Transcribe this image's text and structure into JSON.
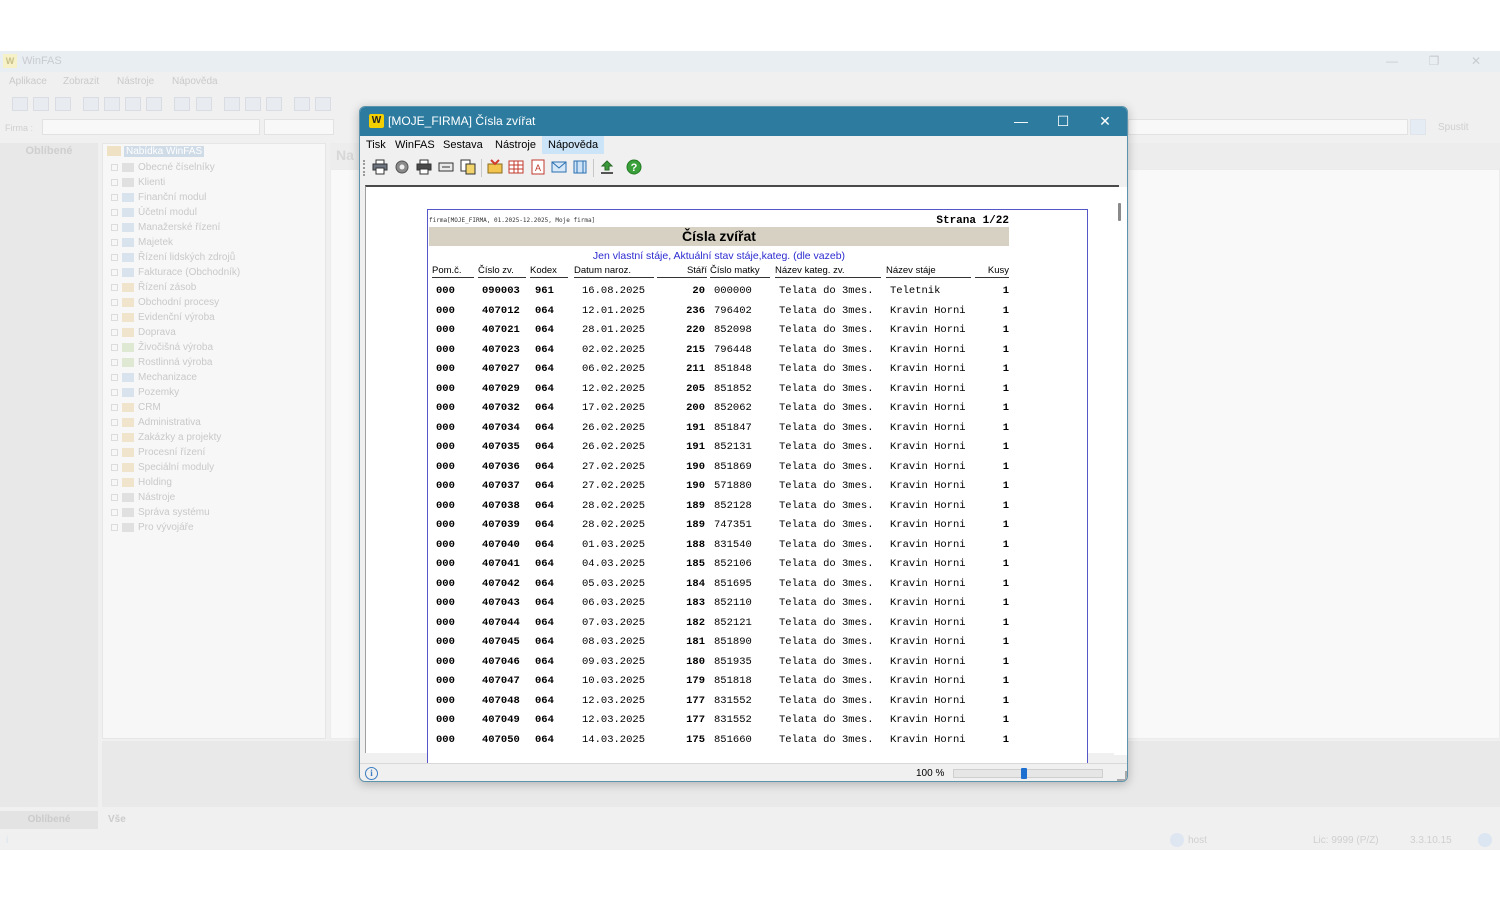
{
  "main_window": {
    "title": "WinFAS",
    "app_icon_text": "W",
    "menu": [
      "Aplikace",
      "Zobrazit",
      "Nástroje",
      "Nápověda"
    ],
    "firma_label": "Firma :",
    "spust_label": "Spustit",
    "favorites_header": "Oblíbené",
    "tree_root": "Nabídka WinFAS",
    "right_header": "Na",
    "tree_items": [
      {
        "label": "Obecné číselníky",
        "color": "gray"
      },
      {
        "label": "Klienti",
        "color": "gray"
      },
      {
        "label": "Finanční modul",
        "color": "blue"
      },
      {
        "label": "Účetní modul",
        "color": "blue"
      },
      {
        "label": "Manažerské řízení",
        "color": "blue"
      },
      {
        "label": "Majetek",
        "color": "blue"
      },
      {
        "label": "Řízení lidských zdrojů",
        "color": "blue"
      },
      {
        "label": "Fakturace (Obchodník)",
        "color": "blue"
      },
      {
        "label": "Řízení zásob",
        "color": "orange"
      },
      {
        "label": "Obchodní procesy",
        "color": "orange"
      },
      {
        "label": "Evidenční výroba",
        "color": "orange"
      },
      {
        "label": "Doprava",
        "color": "orange"
      },
      {
        "label": "Živočišná výroba",
        "color": "green"
      },
      {
        "label": "Rostlinná výroba",
        "color": "green"
      },
      {
        "label": "Mechanizace",
        "color": "blue"
      },
      {
        "label": "Pozemky",
        "color": "blue"
      },
      {
        "label": "CRM",
        "color": "orange"
      },
      {
        "label": "Administrativa",
        "color": "orange"
      },
      {
        "label": "Zakázky a projekty",
        "color": "orange"
      },
      {
        "label": "Procesní řízení",
        "color": "orange"
      },
      {
        "label": "Speciální moduly",
        "color": "orange"
      },
      {
        "label": "Holding",
        "color": "orange"
      },
      {
        "label": "Nástroje",
        "color": "gray"
      },
      {
        "label": "Správa systému",
        "color": "gray"
      },
      {
        "label": "Pro vývojáře",
        "color": "gray"
      }
    ],
    "bottom_tabs": {
      "favorites": "Oblíbené",
      "all": "Vše"
    },
    "status": {
      "user": "host",
      "license": "Lic: 9999 (P/Z)",
      "version": "3.3.10.15",
      "info": "i"
    }
  },
  "report_window": {
    "title": "[MOJE_FIRMA] Čísla zvířat",
    "app_icon_text": "W",
    "controls": {
      "minimize": "—",
      "maximize": "☐",
      "close": "✕"
    },
    "menu": [
      {
        "label": "Tisk",
        "active": false
      },
      {
        "label": "WinFAS",
        "active": false
      },
      {
        "label": "Sestava",
        "active": false
      },
      {
        "label": "Nástroje",
        "active": false
      },
      {
        "label": "Nápověda",
        "active": true
      }
    ],
    "status": {
      "info": "i",
      "zoom_label": "100 %",
      "zoom_value": 0.47
    }
  },
  "report": {
    "meta": "firma[MOJE_FIRMA, 01.2025-12.2025, Moje firma]",
    "page": "Strana 1/22",
    "title": "Čísla zvířat",
    "filter": "Jen vlastní stáje, Aktuální stav stáje,kateg. (dle vazeb)",
    "columns": {
      "pom": "Pom.č.",
      "cislo": "Číslo zv.",
      "kodex": "Kodex",
      "datum": "Datum naroz.",
      "stari": "Stáří",
      "matka": "Číslo matky",
      "kateg": "Název kateg. zv.",
      "staj": "Název stáje",
      "kusy": "Kusy"
    },
    "rows": [
      [
        "000",
        "090003",
        "961",
        "16.08.2025",
        "20",
        "000000",
        "Telata do 3mes.",
        "Teletnik",
        "1"
      ],
      [
        "000",
        "407012",
        "064",
        "12.01.2025",
        "236",
        "796402",
        "Telata do 3mes.",
        "Kravin Horni",
        "1"
      ],
      [
        "000",
        "407021",
        "064",
        "28.01.2025",
        "220",
        "852098",
        "Telata do 3mes.",
        "Kravin Horni",
        "1"
      ],
      [
        "000",
        "407023",
        "064",
        "02.02.2025",
        "215",
        "796448",
        "Telata do 3mes.",
        "Kravin Horni",
        "1"
      ],
      [
        "000",
        "407027",
        "064",
        "06.02.2025",
        "211",
        "851848",
        "Telata do 3mes.",
        "Kravin Horni",
        "1"
      ],
      [
        "000",
        "407029",
        "064",
        "12.02.2025",
        "205",
        "851852",
        "Telata do 3mes.",
        "Kravin Horni",
        "1"
      ],
      [
        "000",
        "407032",
        "064",
        "17.02.2025",
        "200",
        "852062",
        "Telata do 3mes.",
        "Kravin Horni",
        "1"
      ],
      [
        "000",
        "407034",
        "064",
        "26.02.2025",
        "191",
        "851847",
        "Telata do 3mes.",
        "Kravin Horni",
        "1"
      ],
      [
        "000",
        "407035",
        "064",
        "26.02.2025",
        "191",
        "852131",
        "Telata do 3mes.",
        "Kravin Horni",
        "1"
      ],
      [
        "000",
        "407036",
        "064",
        "27.02.2025",
        "190",
        "851869",
        "Telata do 3mes.",
        "Kravin Horni",
        "1"
      ],
      [
        "000",
        "407037",
        "064",
        "27.02.2025",
        "190",
        "571880",
        "Telata do 3mes.",
        "Kravin Horni",
        "1"
      ],
      [
        "000",
        "407038",
        "064",
        "28.02.2025",
        "189",
        "852128",
        "Telata do 3mes.",
        "Kravin Horni",
        "1"
      ],
      [
        "000",
        "407039",
        "064",
        "28.02.2025",
        "189",
        "747351",
        "Telata do 3mes.",
        "Kravin Horni",
        "1"
      ],
      [
        "000",
        "407040",
        "064",
        "01.03.2025",
        "188",
        "831540",
        "Telata do 3mes.",
        "Kravin Horni",
        "1"
      ],
      [
        "000",
        "407041",
        "064",
        "04.03.2025",
        "185",
        "852106",
        "Telata do 3mes.",
        "Kravin Horni",
        "1"
      ],
      [
        "000",
        "407042",
        "064",
        "05.03.2025",
        "184",
        "851695",
        "Telata do 3mes.",
        "Kravin Horni",
        "1"
      ],
      [
        "000",
        "407043",
        "064",
        "06.03.2025",
        "183",
        "852110",
        "Telata do 3mes.",
        "Kravin Horni",
        "1"
      ],
      [
        "000",
        "407044",
        "064",
        "07.03.2025",
        "182",
        "852121",
        "Telata do 3mes.",
        "Kravin Horni",
        "1"
      ],
      [
        "000",
        "407045",
        "064",
        "08.03.2025",
        "181",
        "851890",
        "Telata do 3mes.",
        "Kravin Horni",
        "1"
      ],
      [
        "000",
        "407046",
        "064",
        "09.03.2025",
        "180",
        "851935",
        "Telata do 3mes.",
        "Kravin Horni",
        "1"
      ],
      [
        "000",
        "407047",
        "064",
        "10.03.2025",
        "179",
        "851818",
        "Telata do 3mes.",
        "Kravin Horni",
        "1"
      ],
      [
        "000",
        "407048",
        "064",
        "12.03.2025",
        "177",
        "831552",
        "Telata do 3mes.",
        "Kravin Horni",
        "1"
      ],
      [
        "000",
        "407049",
        "064",
        "12.03.2025",
        "177",
        "831552",
        "Telata do 3mes.",
        "Kravin Horni",
        "1"
      ],
      [
        "000",
        "407050",
        "064",
        "14.03.2025",
        "175",
        "851660",
        "Telata do 3mes.",
        "Kravin Horni",
        "1"
      ]
    ]
  }
}
